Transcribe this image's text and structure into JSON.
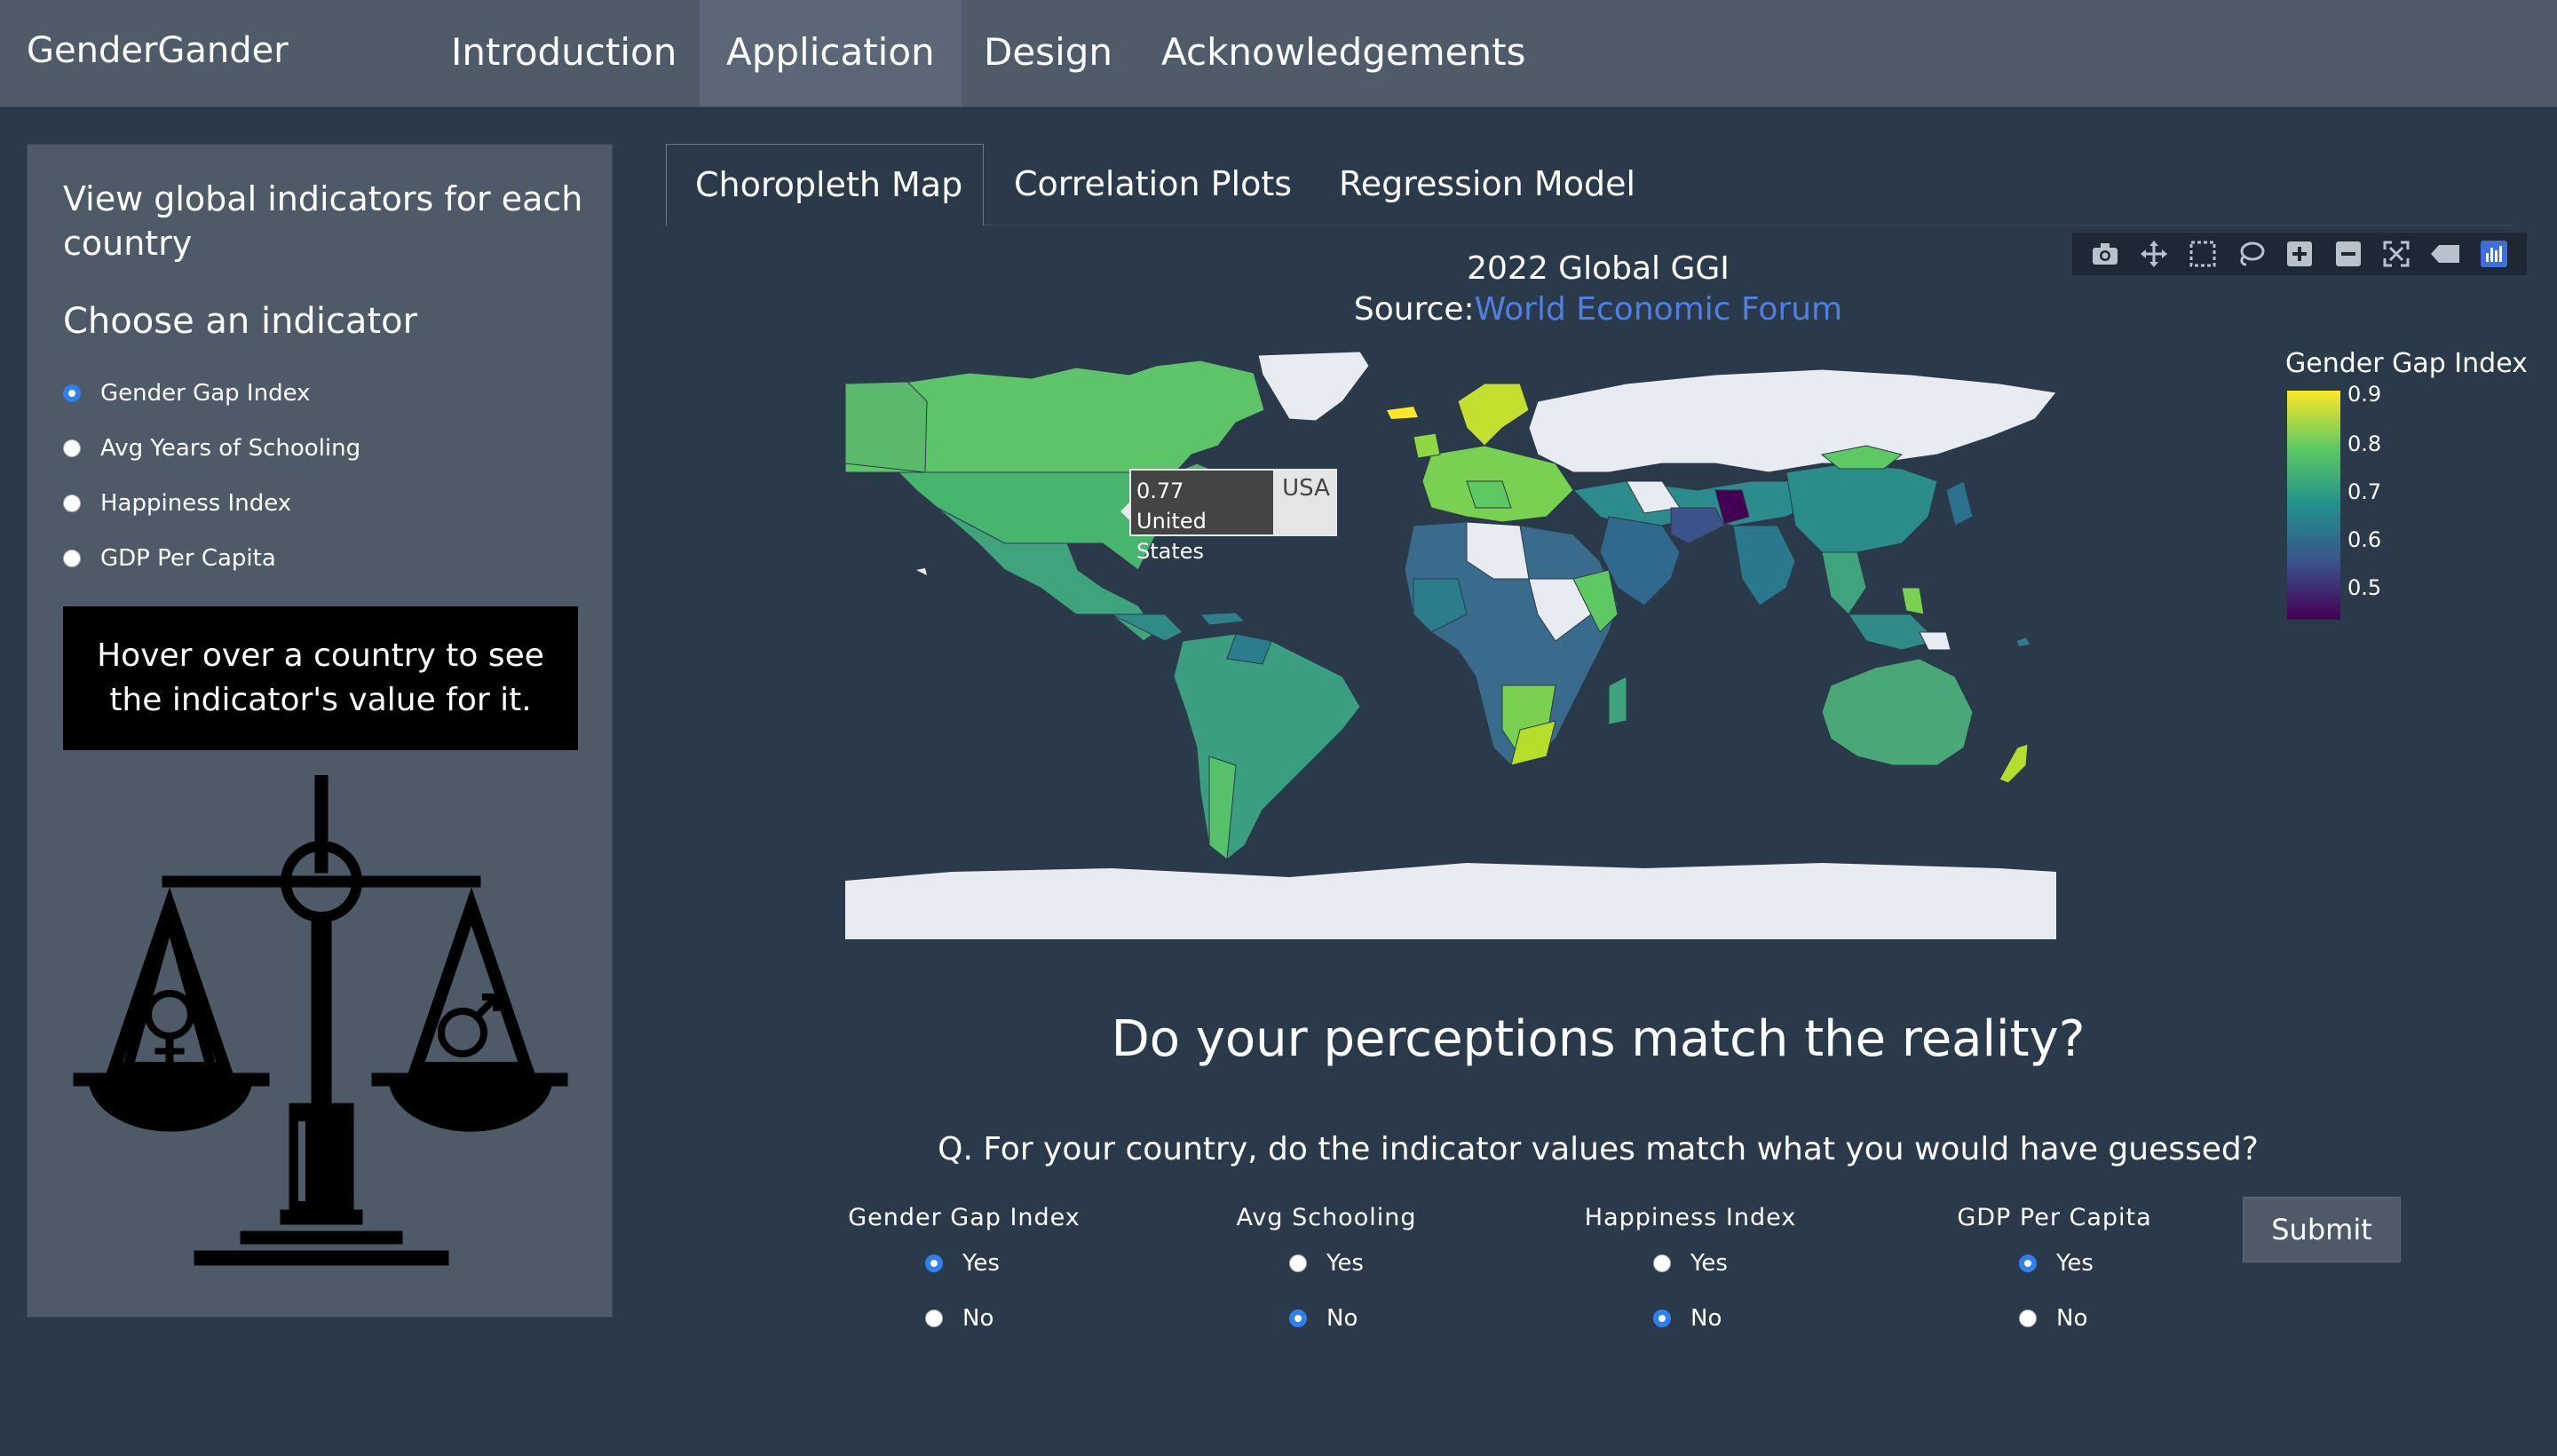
{
  "navbar": {
    "brand": "GenderGander",
    "links": [
      "Introduction",
      "Application",
      "Design",
      "Acknowledgements"
    ],
    "active": "Application"
  },
  "sidebar": {
    "heading": "View global indicators for each country",
    "choose_label": "Choose an indicator",
    "options": [
      "Gender Gap Index",
      "Avg Years of Schooling",
      "Happiness Index",
      "GDP Per Capita"
    ],
    "selected": "Gender Gap Index",
    "hover_text": "Hover over a country to see the indicator's value for it."
  },
  "tabs": {
    "items": [
      "Choropleth Map",
      "Correlation Plots",
      "Regression Model"
    ],
    "active": "Choropleth Map"
  },
  "plot": {
    "title": "2022 Global GGI",
    "source_prefix": "Source:",
    "source_link": "World Economic Forum",
    "colorbar_title": "Gender Gap Index",
    "colorbar_ticks": [
      "0.9",
      "0.8",
      "0.7",
      "0.6",
      "0.5"
    ],
    "tooltip": {
      "value": "0.77",
      "country": "United States",
      "code": "USA"
    },
    "modebar_icons": [
      "camera-icon",
      "pan-icon",
      "box-select-icon",
      "lasso-icon",
      "zoom-in-icon",
      "zoom-out-icon",
      "autoscale-icon",
      "reset-icon",
      "plotly-logo-icon"
    ],
    "colors": {
      "background": "#2b3a4a",
      "no_data": "#e8ecf2",
      "low": "#440154",
      "high": "#fde725"
    }
  },
  "question": {
    "heading": "Do your perceptions match the reality?",
    "text": "Q. For your country, do the indicator values match what you would have guessed?",
    "groups": [
      {
        "label": "Gender Gap Index",
        "yes": "Yes",
        "no": "No",
        "selected": "Yes"
      },
      {
        "label": "Avg Schooling",
        "yes": "Yes",
        "no": "No",
        "selected": "No"
      },
      {
        "label": "Happiness Index",
        "yes": "Yes",
        "no": "No",
        "selected": "No"
      },
      {
        "label": "GDP Per Capita",
        "yes": "Yes",
        "no": "No",
        "selected": "Yes"
      }
    ],
    "submit_label": "Submit"
  }
}
